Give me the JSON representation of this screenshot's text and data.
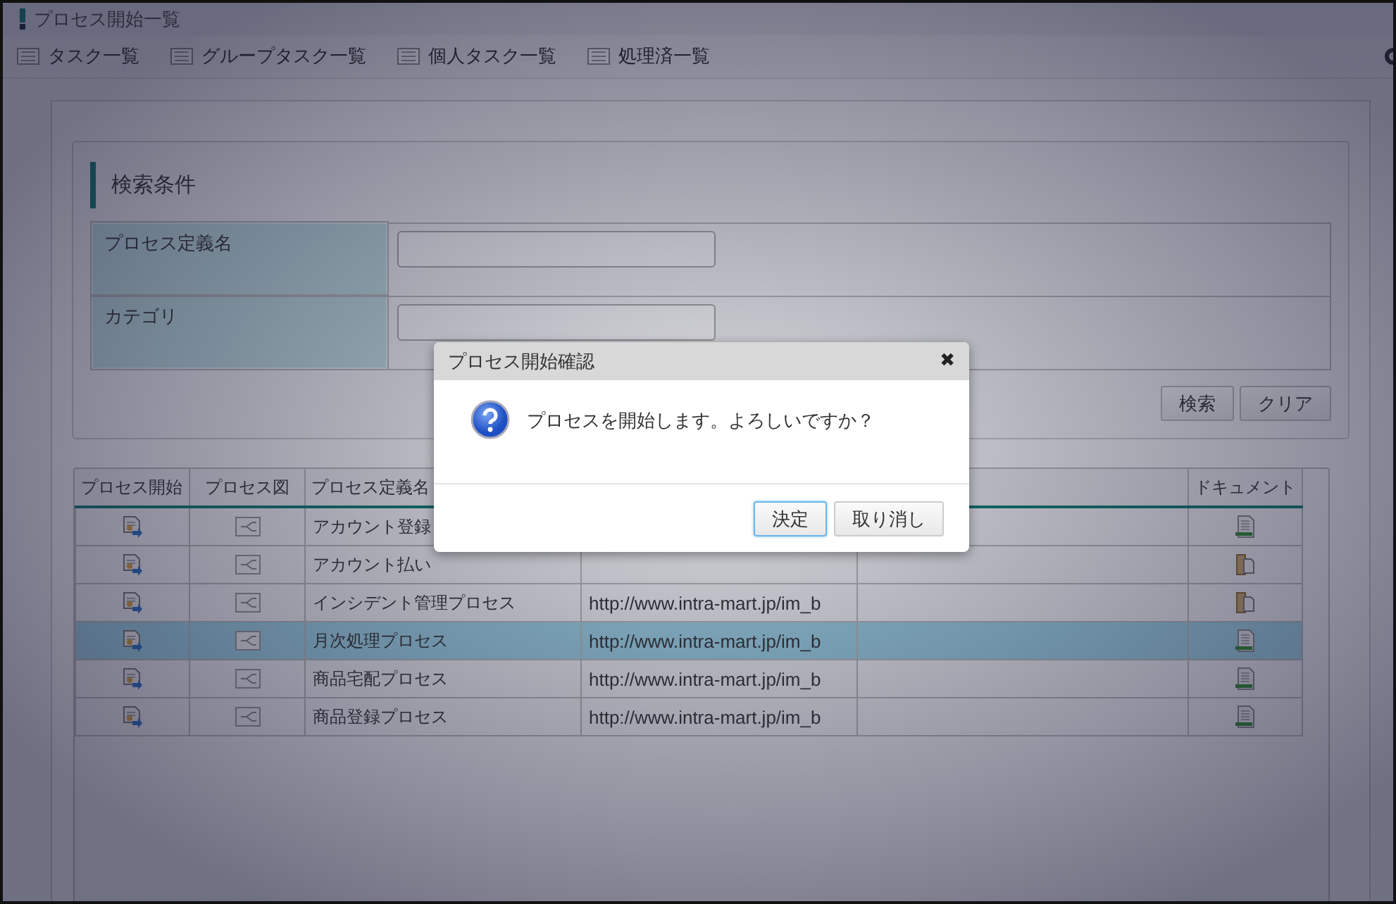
{
  "window": {
    "title": "プロセス開始一覧"
  },
  "nav": [
    {
      "label": "タスク一覧"
    },
    {
      "label": "グループタスク一覧"
    },
    {
      "label": "個人タスク一覧"
    },
    {
      "label": "処理済一覧"
    }
  ],
  "search": {
    "title": "検索条件",
    "fields": [
      {
        "label": "プロセス定義名"
      },
      {
        "label": "カテゴリ"
      }
    ],
    "buttons": [
      "検索",
      "クリア"
    ]
  },
  "table": {
    "columns": [
      {
        "label": "プロセス開始"
      },
      {
        "label": "プロセス図"
      },
      {
        "label": "プロセス定義名"
      },
      {},
      {},
      {
        "label": "ドキュメント"
      }
    ],
    "rows": [
      {
        "name": "アカウント登録",
        "kind": "sheet",
        "selected": false
      },
      {
        "name": "アカウント払い",
        "kind": "folder",
        "selected": false
      },
      {
        "name": "インシデント管理プロセス",
        "url": "http://www.intra-mart.jp/im_b",
        "kind": "folder",
        "selected": false
      },
      {
        "name": "月次処理プロセス",
        "url": "http://www.intra-mart.jp/im_b",
        "kind": "sheet",
        "selected": true
      },
      {
        "name": "商品宅配プロセス",
        "url": "http://www.intra-mart.jp/im_b",
        "kind": "sheet",
        "selected": false
      },
      {
        "name": "商品登録プロセス",
        "url": "http://www.intra-mart.jp/im_b",
        "kind": "sheet",
        "selected": false
      }
    ]
  },
  "dialog": {
    "title": "プロセス開始確認",
    "close": "✖",
    "message": "プロセスを開始します。よろしいですか？",
    "buttons": [
      {
        "label": "決定",
        "focused": true
      },
      {
        "label": "取り消し",
        "focused": false
      }
    ]
  }
}
